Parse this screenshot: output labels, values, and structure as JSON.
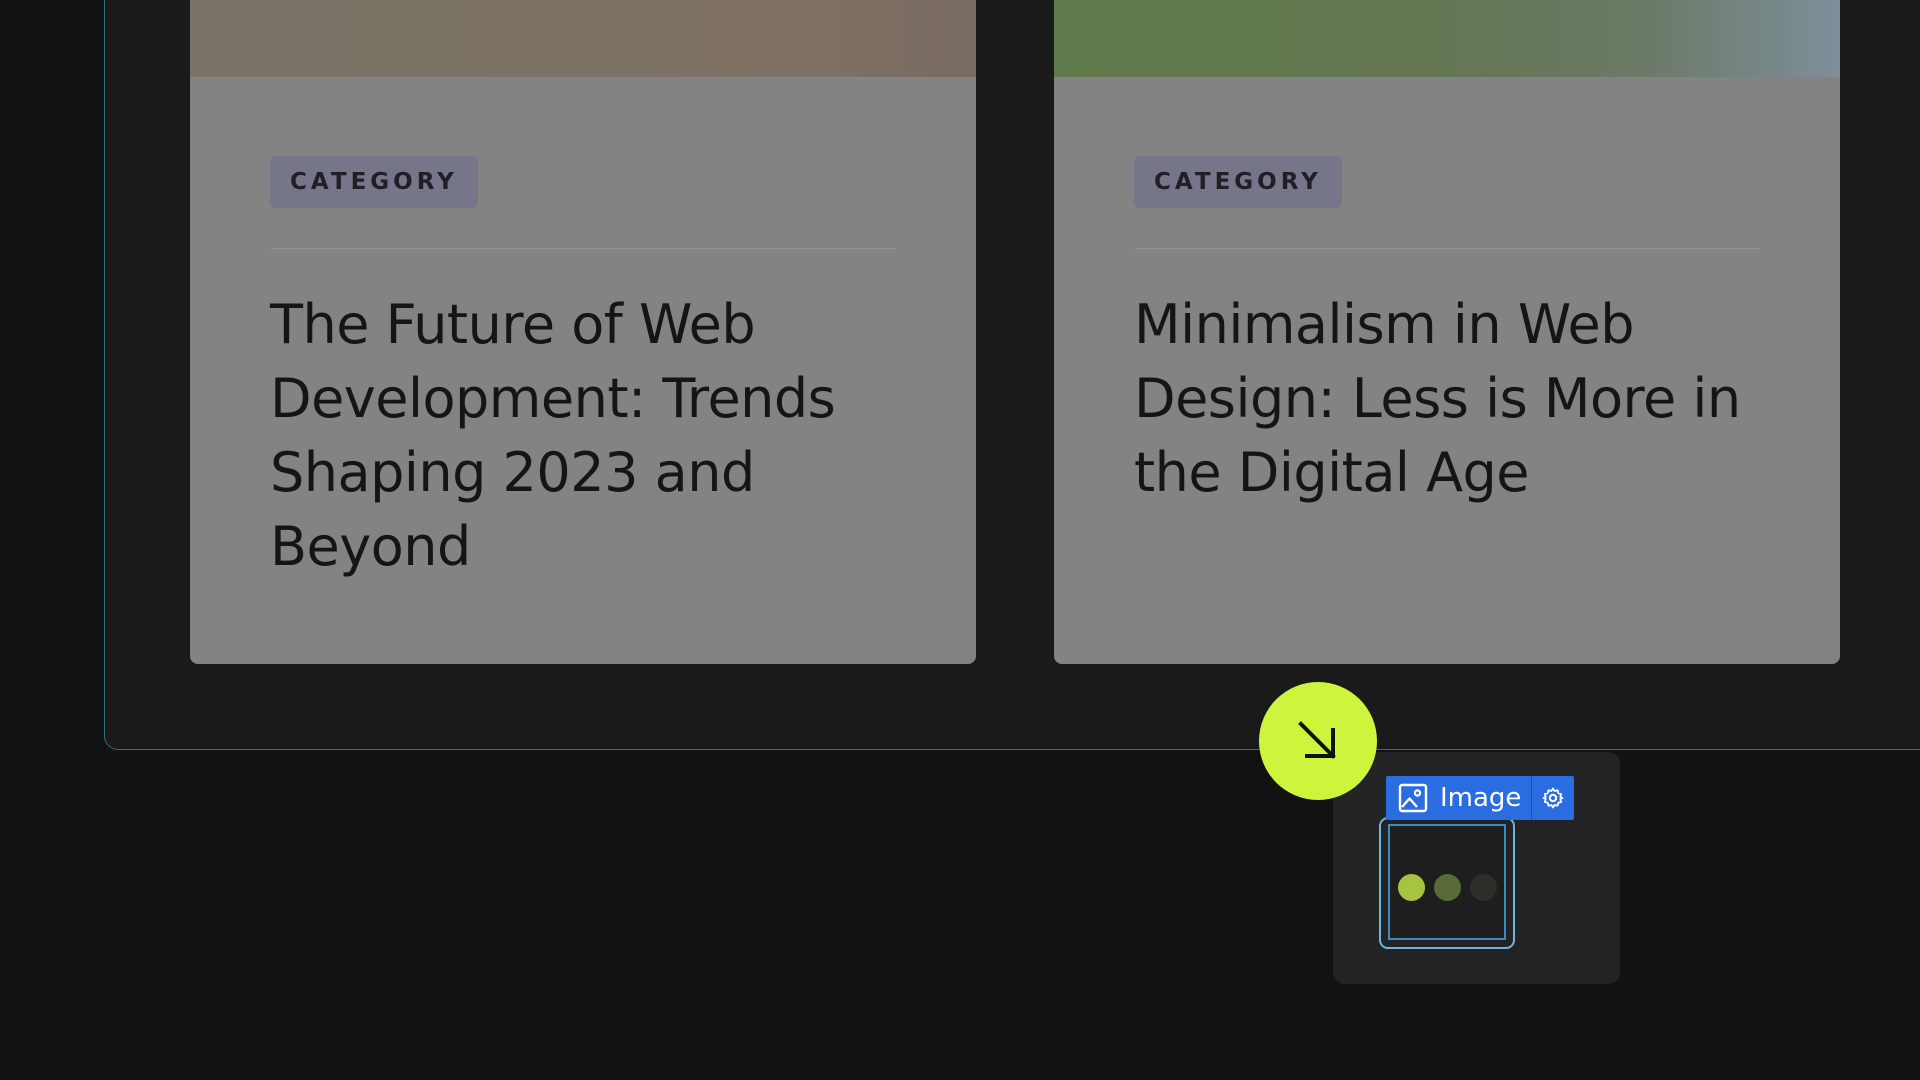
{
  "cards": [
    {
      "category": "CATEGORY",
      "title": "The Future of Web Development: Trends Shaping 2023 and Beyond"
    },
    {
      "category": "CATEGORY",
      "title": "Minimalism in Web Design: Less is More in the Digital Age"
    }
  ],
  "fab": {
    "icon": "arrow-down-right-icon",
    "color": "#cdf53b"
  },
  "element_tag": {
    "label": "Image",
    "type_icon": "image-icon",
    "settings_icon": "gear-icon",
    "color": "#2a6de0"
  },
  "placeholder": {
    "dots": [
      {
        "color": "#a7c441"
      },
      {
        "color": "#5b6b38"
      },
      {
        "color": "#2c2e27"
      }
    ]
  }
}
